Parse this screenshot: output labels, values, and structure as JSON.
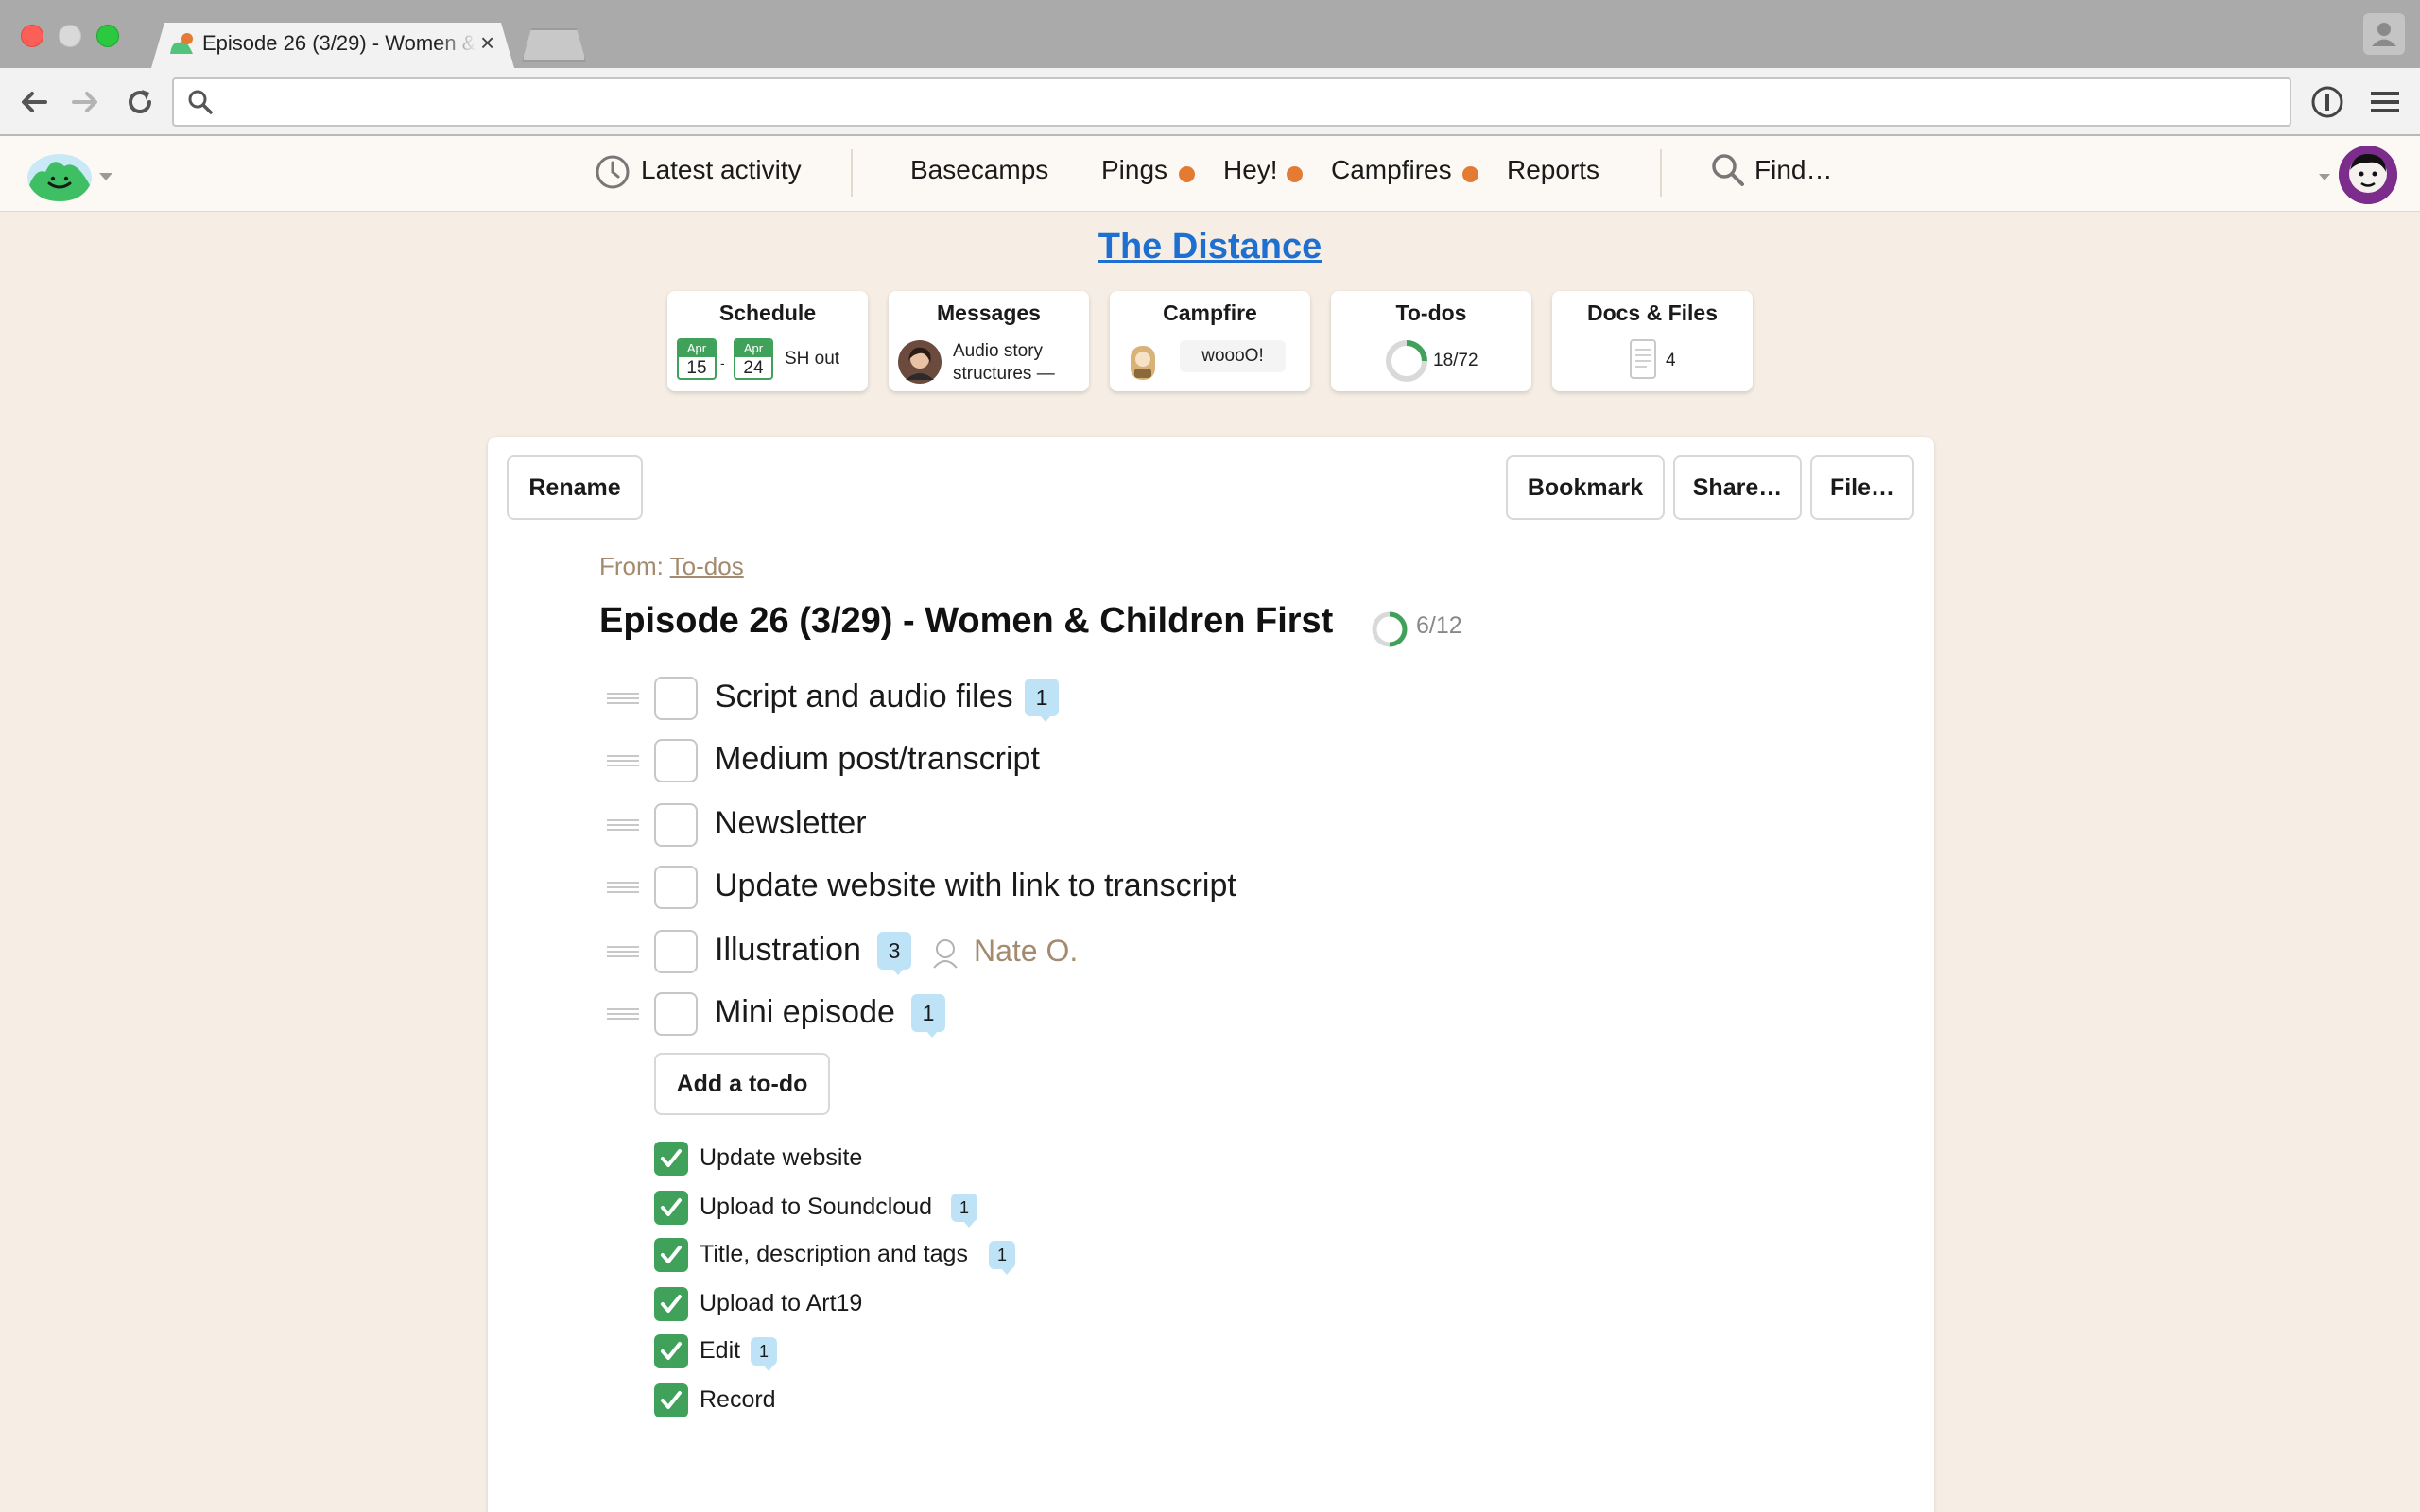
{
  "browser": {
    "tab_title": "Episode 26 (3/29) - Women & Children First",
    "tab_close": "×",
    "address": ""
  },
  "nav": {
    "latest_activity": "Latest activity",
    "basecamps": "Basecamps",
    "pings": "Pings",
    "hey": "Hey!",
    "campfires": "Campfires",
    "reports": "Reports",
    "find": "Find…",
    "notification_color": "#e57b33"
  },
  "project": {
    "title": "The Distance"
  },
  "cards": {
    "schedule": {
      "title": "Schedule",
      "start_month": "Apr",
      "start_day": "15",
      "dash": "-",
      "end_month": "Apr",
      "end_day": "24",
      "event": "SH out"
    },
    "messages": {
      "title": "Messages",
      "preview_line1": "Audio story",
      "preview_line2": "structures —"
    },
    "campfire": {
      "title": "Campfire",
      "last_message": "woooO!"
    },
    "todos": {
      "title": "To-dos",
      "completed": 18,
      "total": 72,
      "progress_label": "18/72"
    },
    "docs": {
      "title": "Docs & Files",
      "count": "4"
    }
  },
  "toolbar": {
    "rename": "Rename",
    "bookmark": "Bookmark",
    "share": "Share…",
    "file": "File…"
  },
  "list": {
    "from_label": "From:",
    "from_link": "To-dos",
    "title": "Episode 26 (3/29) - Women & Children First",
    "completed": 6,
    "total": 12,
    "progress_label": "6/12",
    "open_items": [
      {
        "text": "Script and audio files",
        "comments": "1"
      },
      {
        "text": "Medium post/transcript"
      },
      {
        "text": "Newsletter"
      },
      {
        "text": "Update website with link to transcript"
      },
      {
        "text": "Illustration",
        "comments": "3",
        "assignee": "Nate O."
      },
      {
        "text": "Mini episode",
        "comments": "1"
      }
    ],
    "add_label": "Add a to-do",
    "done_items": [
      {
        "text": "Update website"
      },
      {
        "text": "Upload to Soundcloud",
        "comments": "1"
      },
      {
        "text": "Title, description and tags",
        "comments": "1"
      },
      {
        "text": "Upload to Art19"
      },
      {
        "text": "Edit",
        "comments": "1"
      },
      {
        "text": "Record"
      }
    ],
    "done_color": "#3fa15a"
  }
}
